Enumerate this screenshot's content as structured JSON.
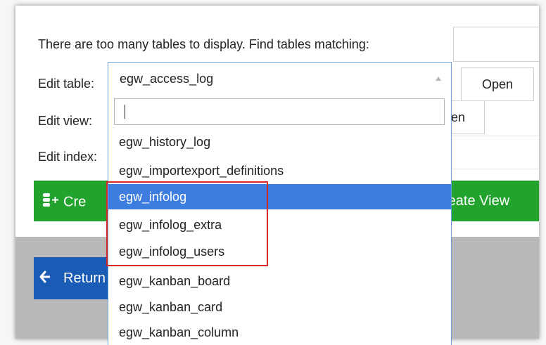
{
  "form": {
    "find_prompt": "There are too many tables to display. Find tables matching:",
    "find_value": "",
    "edit_table_label": "Edit table:",
    "edit_view_label": "Edit view:",
    "edit_index_label": "Edit index:",
    "selected_table": "egw_access_log",
    "open_label": "Open",
    "open_view_partial": "en"
  },
  "dropdown": {
    "search_value": "",
    "options": [
      {
        "label": "egw_history_log",
        "selected": false
      },
      {
        "label": "egw_importexport_definitions",
        "selected": false
      },
      {
        "label": "egw_infolog",
        "selected": true
      },
      {
        "label": "egw_infolog_extra",
        "selected": false
      },
      {
        "label": "egw_infolog_users",
        "selected": false
      },
      {
        "label": "egw_kanban_board",
        "selected": false
      },
      {
        "label": "egw_kanban_card",
        "selected": false
      },
      {
        "label": "egw_kanban_column",
        "selected": false
      }
    ]
  },
  "actions": {
    "create_table_partial": "Cre",
    "create_view_partial": "reate View",
    "return_partial": "Return"
  },
  "colors": {
    "green": "#21a32e",
    "blue": "#1a5bb5",
    "selection": "#3e7de0",
    "highlight": "#d32a2a"
  }
}
